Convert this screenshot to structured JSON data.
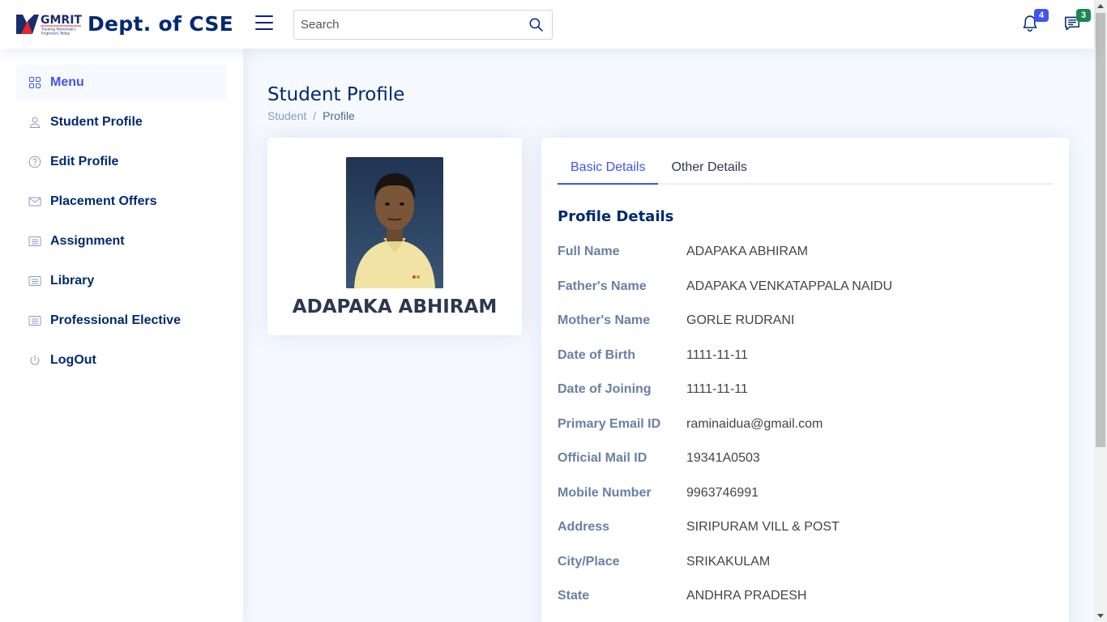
{
  "header": {
    "logo_text": "GMRIT",
    "logo_tagline": "Training Tomorrow's Engineers Today",
    "title": "Dept. of CSE",
    "search_placeholder": "Search",
    "notifications_count": "4",
    "messages_count": "3"
  },
  "sidebar": {
    "items": [
      {
        "label": "Menu",
        "icon": "grid-icon",
        "active": true
      },
      {
        "label": "Student Profile",
        "icon": "person-icon"
      },
      {
        "label": "Edit Profile",
        "icon": "question-circle-icon"
      },
      {
        "label": "Placement Offers",
        "icon": "envelope-icon"
      },
      {
        "label": "Assignment",
        "icon": "card-list-icon"
      },
      {
        "label": "Library",
        "icon": "card-list-icon"
      },
      {
        "label": "Professional Elective",
        "icon": "card-list-icon"
      },
      {
        "label": "LogOut",
        "icon": "power-icon"
      }
    ]
  },
  "page": {
    "title": "Student Profile",
    "breadcrumb": [
      "Student",
      "Profile"
    ]
  },
  "profile": {
    "name": "ADAPAKA ABHIRAM"
  },
  "tabs": [
    "Basic Details",
    "Other Details"
  ],
  "details": {
    "section_title": "Profile Details",
    "rows": [
      {
        "label": "Full Name",
        "value": "ADAPAKA ABHIRAM"
      },
      {
        "label": "Father's Name",
        "value": "ADAPAKA VENKATAPPALA NAIDU"
      },
      {
        "label": "Mother's Name",
        "value": "GORLE RUDRANI"
      },
      {
        "label": "Date of Birth",
        "value": "1111-11-11"
      },
      {
        "label": "Date of Joining",
        "value": "1111-11-11"
      },
      {
        "label": "Primary Email ID",
        "value": "raminaidua@gmail.com"
      },
      {
        "label": "Official Mail ID",
        "value": "19341A0503"
      },
      {
        "label": "Mobile Number",
        "value": "9963746991"
      },
      {
        "label": "Address",
        "value": "SIRIPURAM VILL & POST"
      },
      {
        "label": "City/Place",
        "value": "SRIKAKULAM"
      },
      {
        "label": "State",
        "value": "ANDHRA PRADESH"
      }
    ]
  },
  "colors": {
    "primary": "#4154f1",
    "navy": "#012970",
    "label": "#6a7fa3",
    "badge_blue": "#4154f1",
    "badge_green": "#198754"
  }
}
